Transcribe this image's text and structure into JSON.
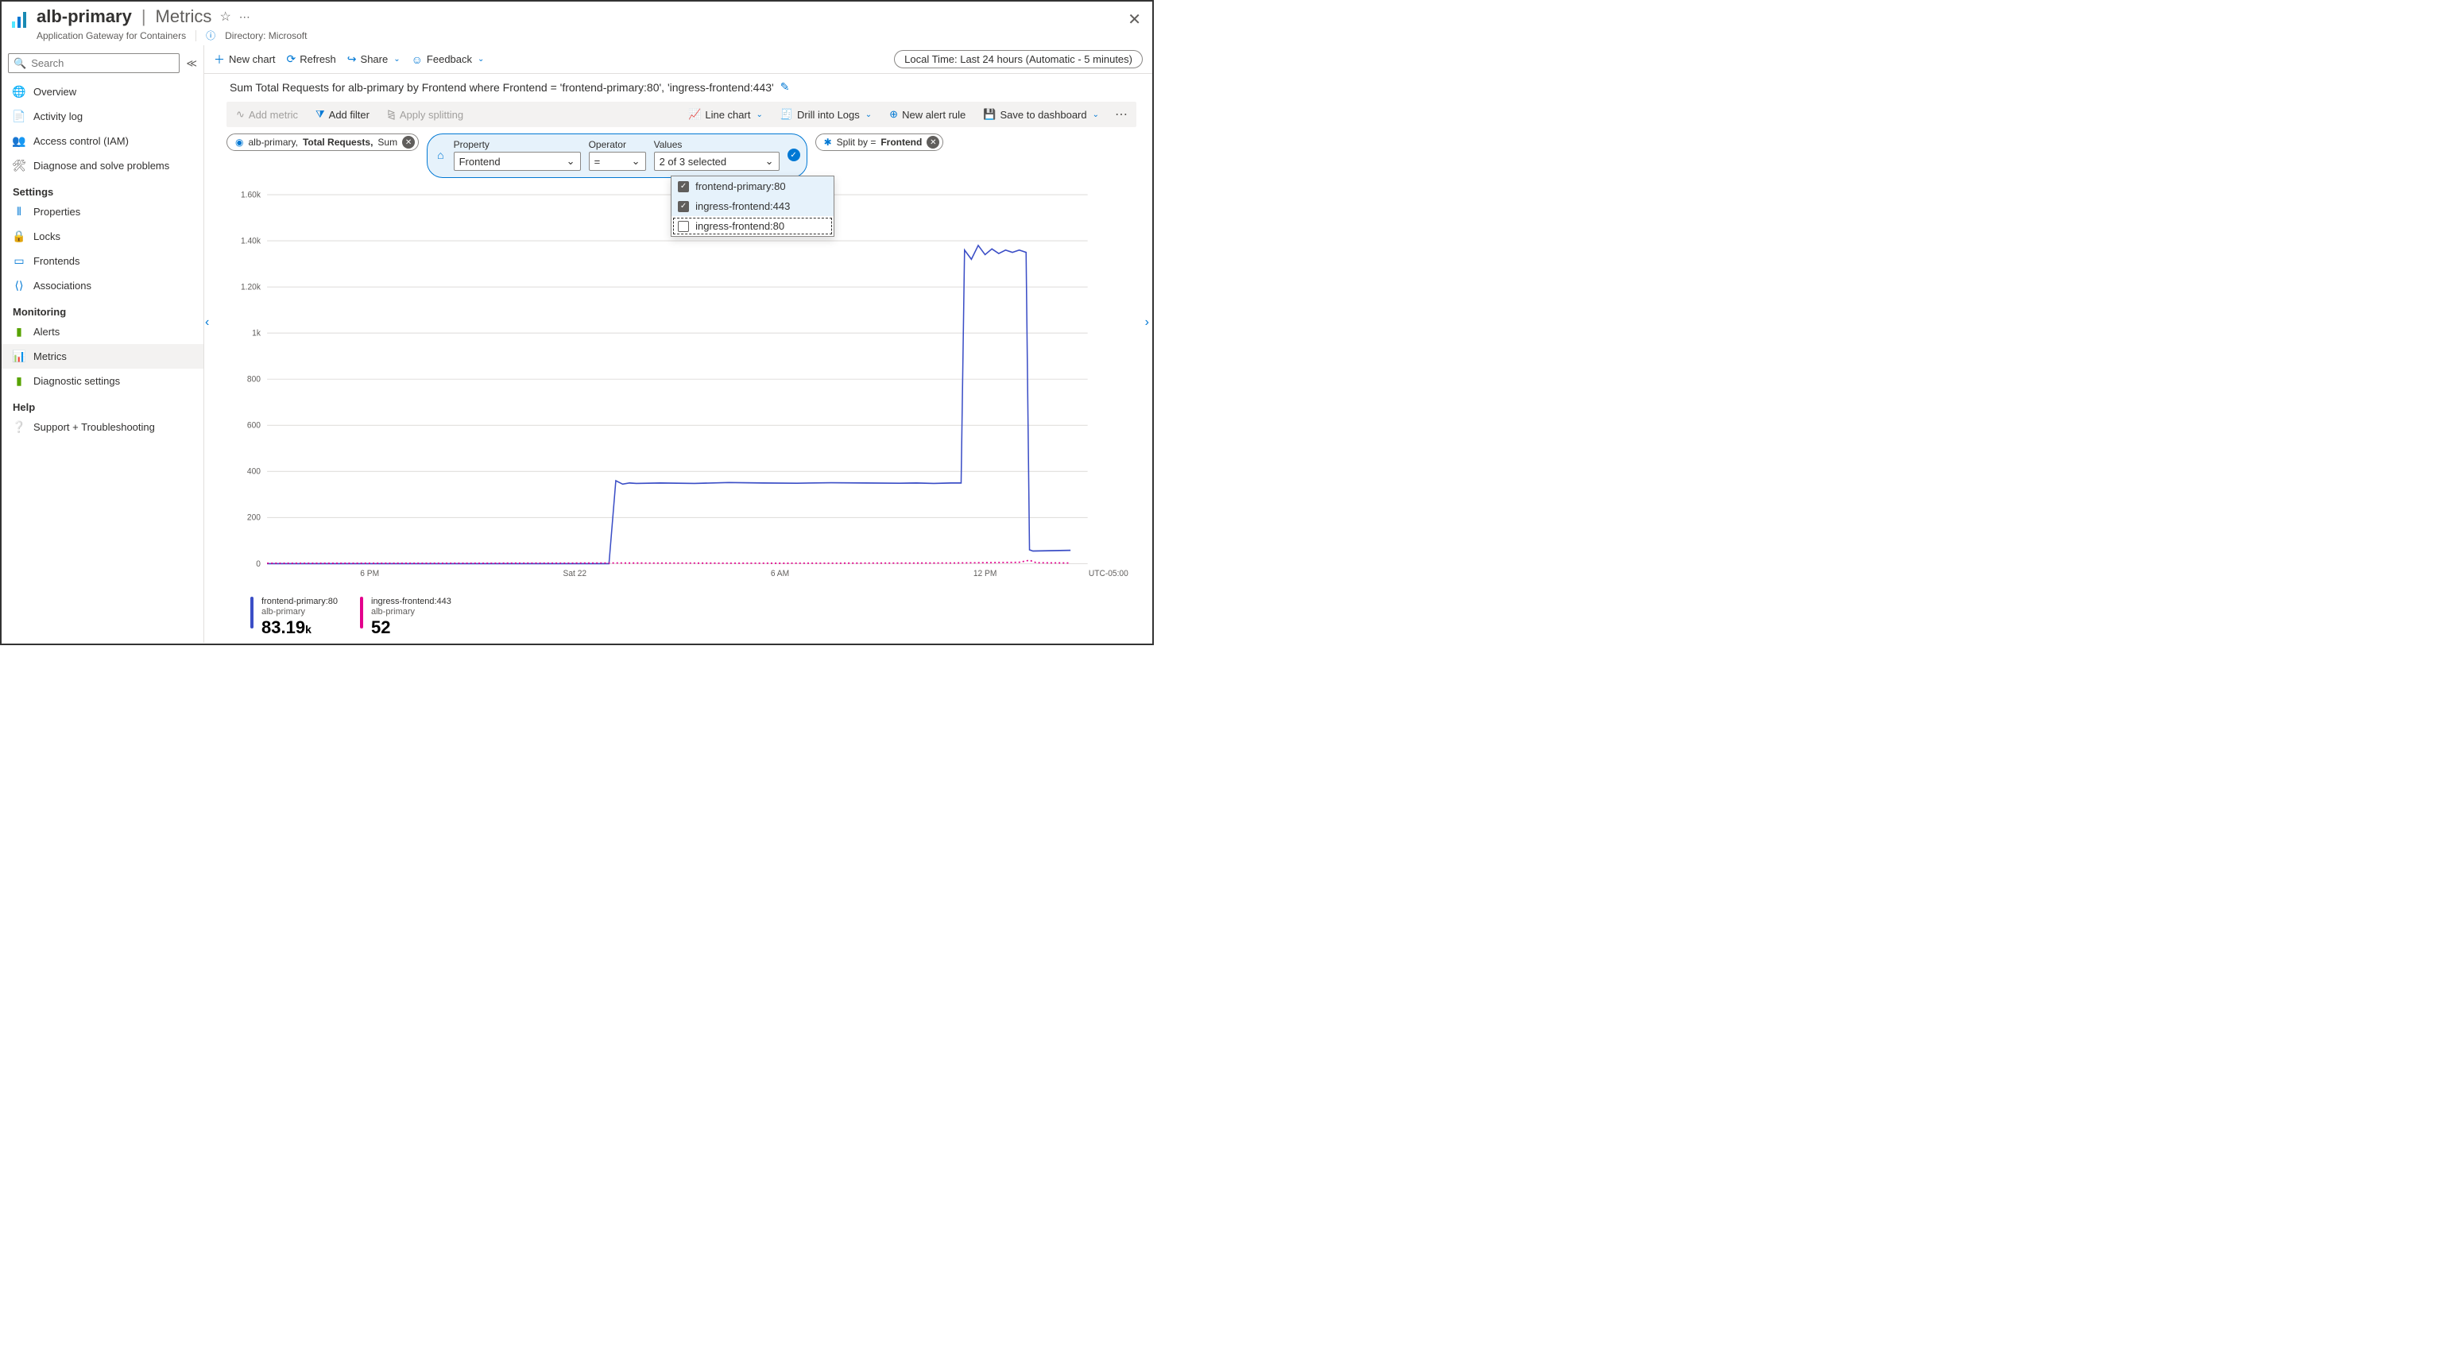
{
  "header": {
    "title": "alb-primary",
    "page": "Metrics",
    "subtitle": "Application Gateway for Containers",
    "directory_label": "Directory: Microsoft"
  },
  "sidebar": {
    "search_placeholder": "Search",
    "top": [
      {
        "icon": "globe",
        "label": "Overview",
        "color": "#0078d4"
      },
      {
        "icon": "list",
        "label": "Activity log",
        "color": "#0078d4"
      },
      {
        "icon": "person",
        "label": "Access control (IAM)",
        "color": "#0078d4"
      },
      {
        "icon": "wrench",
        "label": "Diagnose and solve problems",
        "color": "#605e5c"
      }
    ],
    "sections": [
      {
        "title": "Settings",
        "items": [
          {
            "icon": "sliders",
            "label": "Properties",
            "color": "#0078d4"
          },
          {
            "icon": "lock",
            "label": "Locks",
            "color": "#0078d4"
          },
          {
            "icon": "card",
            "label": "Frontends",
            "color": "#0078d4"
          },
          {
            "icon": "link",
            "label": "Associations",
            "color": "#0078d4"
          }
        ]
      },
      {
        "title": "Monitoring",
        "items": [
          {
            "icon": "bell",
            "label": "Alerts",
            "color": "#57A300"
          },
          {
            "icon": "bars",
            "label": "Metrics",
            "selected": true,
            "color": "#0078d4"
          },
          {
            "icon": "gear",
            "label": "Diagnostic settings",
            "color": "#57A300"
          }
        ]
      },
      {
        "title": "Help",
        "items": [
          {
            "icon": "help",
            "label": "Support + Troubleshooting",
            "color": "#0078d4"
          }
        ]
      }
    ]
  },
  "toolbar": {
    "new_chart": "New chart",
    "refresh": "Refresh",
    "share": "Share",
    "feedback": "Feedback",
    "time_range": "Local Time: Last 24 hours (Automatic - 5 minutes)"
  },
  "chart_title": "Sum Total Requests for alb-primary by Frontend where Frontend = 'frontend-primary:80', 'ingress-frontend:443'",
  "chart_toolbar": {
    "add_metric": "Add metric",
    "add_filter": "Add filter",
    "apply_splitting": "Apply splitting",
    "line_chart": "Line chart",
    "drill_logs": "Drill into Logs",
    "new_alert": "New alert rule",
    "save_dash": "Save to dashboard"
  },
  "metric_pill": {
    "resource": "alb-primary,",
    "metric": "Total Requests,",
    "agg": "Sum"
  },
  "filter": {
    "property_label": "Property",
    "property_value": "Frontend",
    "operator_label": "Operator",
    "operator_value": "=",
    "values_label": "Values",
    "values_display": "2 of 3 selected",
    "options": [
      {
        "label": "frontend-primary:80",
        "checked": true
      },
      {
        "label": "ingress-frontend:443",
        "checked": true
      },
      {
        "label": "ingress-frontend:80",
        "checked": false
      }
    ]
  },
  "split_pill": {
    "prefix": "Split by = ",
    "value": "Frontend"
  },
  "chart_data": {
    "type": "line",
    "xlabel": "",
    "ylabel": "",
    "ylim": [
      0,
      1600
    ],
    "y_ticks": [
      "1.60k",
      "1.40k",
      "1.20k",
      "1k",
      "800",
      "600",
      "400",
      "200",
      "0"
    ],
    "x_ticks": [
      "6 PM",
      "Sat 22",
      "6 AM",
      "12 PM"
    ],
    "x_right_label": "UTC-05:00",
    "x_range_hours": 24,
    "series": [
      {
        "name": "frontend-primary:80",
        "resource": "alb-primary",
        "color": "#3b4ec6",
        "summary_value": "83.19",
        "summary_unit": "k",
        "points": [
          [
            0,
            0
          ],
          [
            10,
            0
          ],
          [
            10.0,
            0
          ],
          [
            10.2,
            360
          ],
          [
            10.4,
            345
          ],
          [
            10.6,
            350
          ],
          [
            10.8,
            348
          ],
          [
            11.5,
            350
          ],
          [
            12.5,
            348
          ],
          [
            13.5,
            352
          ],
          [
            14.5,
            350
          ],
          [
            15.5,
            349
          ],
          [
            16.5,
            351
          ],
          [
            17.5,
            350
          ],
          [
            18.5,
            349
          ],
          [
            19.0,
            350
          ],
          [
            19.5,
            348
          ],
          [
            20.0,
            350
          ],
          [
            20.3,
            350
          ],
          [
            20.4,
            1360
          ],
          [
            20.6,
            1320
          ],
          [
            20.8,
            1380
          ],
          [
            21.0,
            1340
          ],
          [
            21.2,
            1365
          ],
          [
            21.4,
            1345
          ],
          [
            21.6,
            1360
          ],
          [
            21.8,
            1350
          ],
          [
            22.0,
            1360
          ],
          [
            22.2,
            1350
          ],
          [
            22.3,
            60
          ],
          [
            22.4,
            55
          ],
          [
            23.5,
            58
          ]
        ]
      },
      {
        "name": "ingress-frontend:443",
        "resource": "alb-primary",
        "color": "#e3008c",
        "summary_value": "52",
        "summary_unit": "",
        "points": [
          [
            0,
            2
          ],
          [
            5,
            2
          ],
          [
            10,
            3
          ],
          [
            15,
            2
          ],
          [
            20,
            3
          ],
          [
            22,
            6
          ],
          [
            22.3,
            15
          ],
          [
            22.5,
            4
          ],
          [
            23.5,
            3
          ]
        ]
      }
    ]
  }
}
